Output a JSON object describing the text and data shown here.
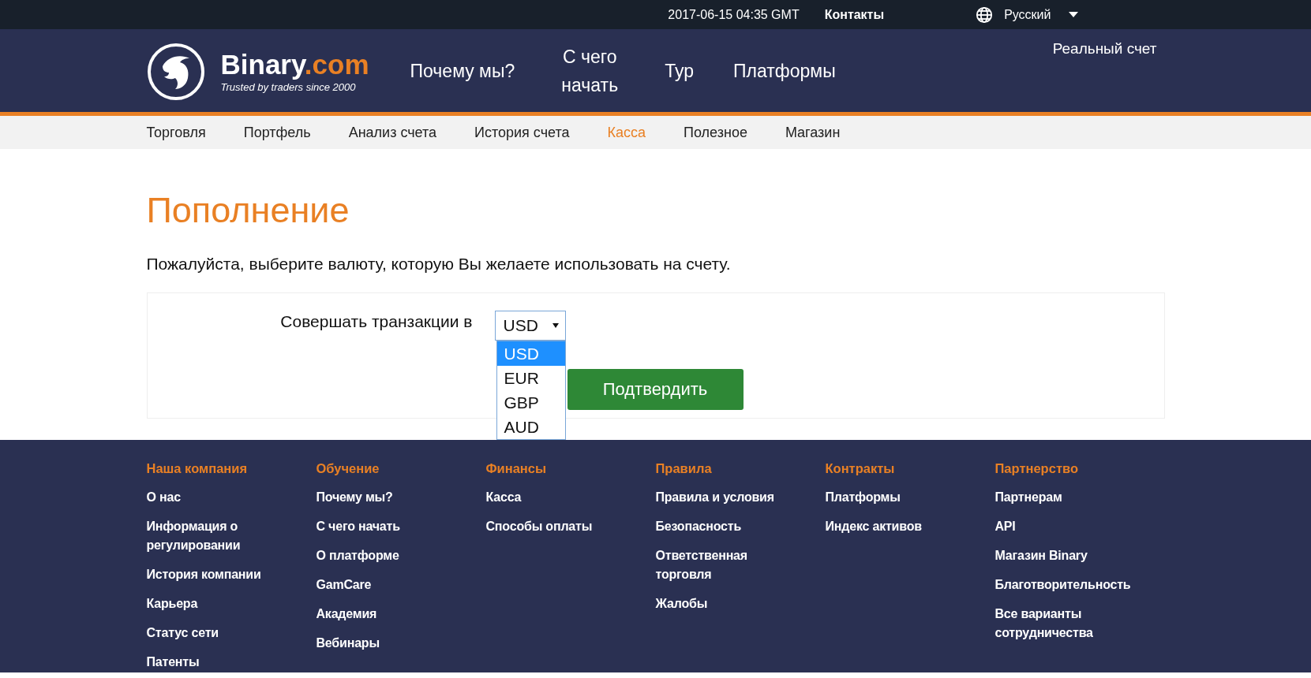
{
  "top_bar": {
    "datetime": "2017-06-15 04:35 GMT",
    "contacts": "Контакты",
    "language": "Русский"
  },
  "header": {
    "logo": {
      "name": "Binary",
      "suffix": ".com",
      "tagline": "Trusted by traders since 2000"
    },
    "nav": [
      "Почему мы?",
      "С чего начать",
      "Тур",
      "Платформы"
    ],
    "account": "Реальный счет"
  },
  "subnav": [
    {
      "label": "Торговля",
      "selected": false
    },
    {
      "label": "Портфель",
      "selected": false
    },
    {
      "label": "Анализ счета",
      "selected": false
    },
    {
      "label": "История счета",
      "selected": false
    },
    {
      "label": "Касса",
      "selected": true
    },
    {
      "label": "Полезное",
      "selected": false
    },
    {
      "label": "Магазин",
      "selected": false
    }
  ],
  "page": {
    "title": "Пополнение",
    "instruction": "Пожалуйста, выберите валюту, которую Вы желаете использовать на счету.",
    "form": {
      "label": "Совершать транзакции в",
      "select": {
        "value": "USD",
        "expanded": true,
        "options": [
          {
            "label": "USD",
            "selected": true
          },
          {
            "label": "EUR",
            "selected": false
          },
          {
            "label": "GBP",
            "selected": false
          },
          {
            "label": "AUD",
            "selected": false
          }
        ]
      },
      "submit": "Подтвердить"
    }
  },
  "footer": {
    "columns": [
      {
        "heading": "Наша компания",
        "links": [
          "О нас",
          "Информация о регулировании",
          "История компании",
          "Карьера",
          "Статус сети",
          "Патенты"
        ]
      },
      {
        "heading": "Обучение",
        "links": [
          "Почему мы?",
          "С чего начать",
          "О платформе",
          "GamCare",
          "Академия",
          "Вебинары"
        ]
      },
      {
        "heading": "Финансы",
        "links": [
          "Касса",
          "Способы оплаты"
        ]
      },
      {
        "heading": "Правила",
        "links": [
          "Правила и условия",
          "Безопасность",
          "Ответственная торговля",
          "Жалобы"
        ]
      },
      {
        "heading": "Контракты",
        "links": [
          "Платформы",
          "Индекс активов"
        ]
      },
      {
        "heading": "Партнерство",
        "links": [
          "Партнерам",
          "API",
          "Магазин Binary",
          "Благотворительность",
          "Все варианты сотрудничества"
        ]
      }
    ]
  }
}
